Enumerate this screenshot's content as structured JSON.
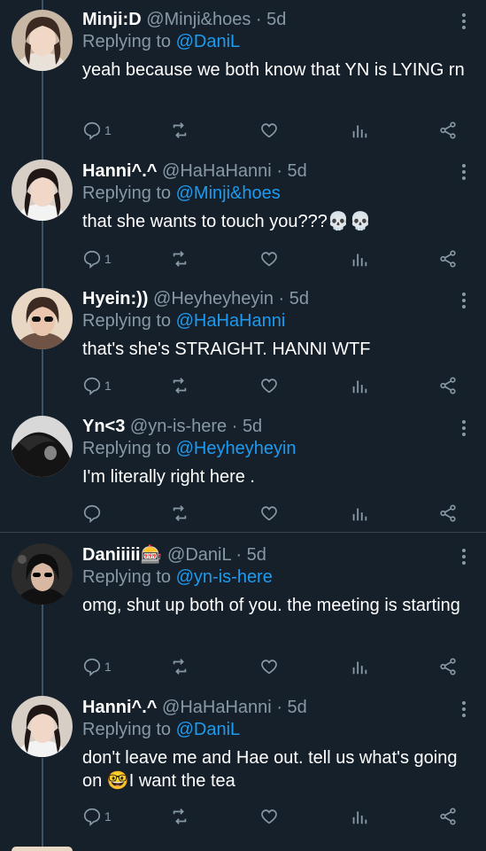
{
  "tweets": [
    {
      "name": "Minji:D",
      "handle": "@Minji&hoes",
      "sep": "·",
      "time": "5d",
      "replying_prefix": "Replying to",
      "replying_to": "@DaniL",
      "text": "yeah because we both know that YN is LYING rn",
      "reply_count": "1"
    },
    {
      "name": "Hanni^.^",
      "handle": "@HaHaHanni",
      "sep": "·",
      "time": "5d",
      "replying_prefix": "Replying to",
      "replying_to": "@Minji&hoes",
      "text": "that she wants to touch you???💀💀",
      "reply_count": "1"
    },
    {
      "name": "Hyein:))",
      "handle": "@Heyheyheyin",
      "sep": "·",
      "time": "5d",
      "replying_prefix": "Replying to",
      "replying_to": "@HaHaHanni",
      "text": "that's she's STRAIGHT. HANNI WTF",
      "reply_count": "1"
    },
    {
      "name": "Yn<3",
      "handle": "@yn-is-here",
      "sep": "·",
      "time": "5d",
      "replying_prefix": "Replying to",
      "replying_to": "@Heyheyheyin",
      "text": "I'm literally right here .",
      "reply_count": ""
    },
    {
      "name": "Daniiiii🎰",
      "handle": "@DaniL",
      "sep": "·",
      "time": "5d",
      "replying_prefix": "Replying to",
      "replying_to": "@yn-is-here",
      "text": "omg, shut up both of you. the meeting is starting",
      "reply_count": "1"
    },
    {
      "name": "Hanni^.^",
      "handle": "@HaHaHanni",
      "sep": "·",
      "time": "5d",
      "replying_prefix": "Replying to",
      "replying_to": "@DaniL",
      "text": "don't leave me and Hae out. tell us what's going on 🤓I want the tea",
      "reply_count": "1"
    }
  ],
  "icons": {
    "reply": "reply-icon",
    "retweet": "retweet-icon",
    "like": "like-icon",
    "views": "views-icon",
    "share": "share-icon",
    "more": "more-icon"
  },
  "colors": {
    "background": "#15202b",
    "secondary_text": "#8899a6",
    "mention": "#1d9bf0",
    "divider": "#38444d"
  }
}
